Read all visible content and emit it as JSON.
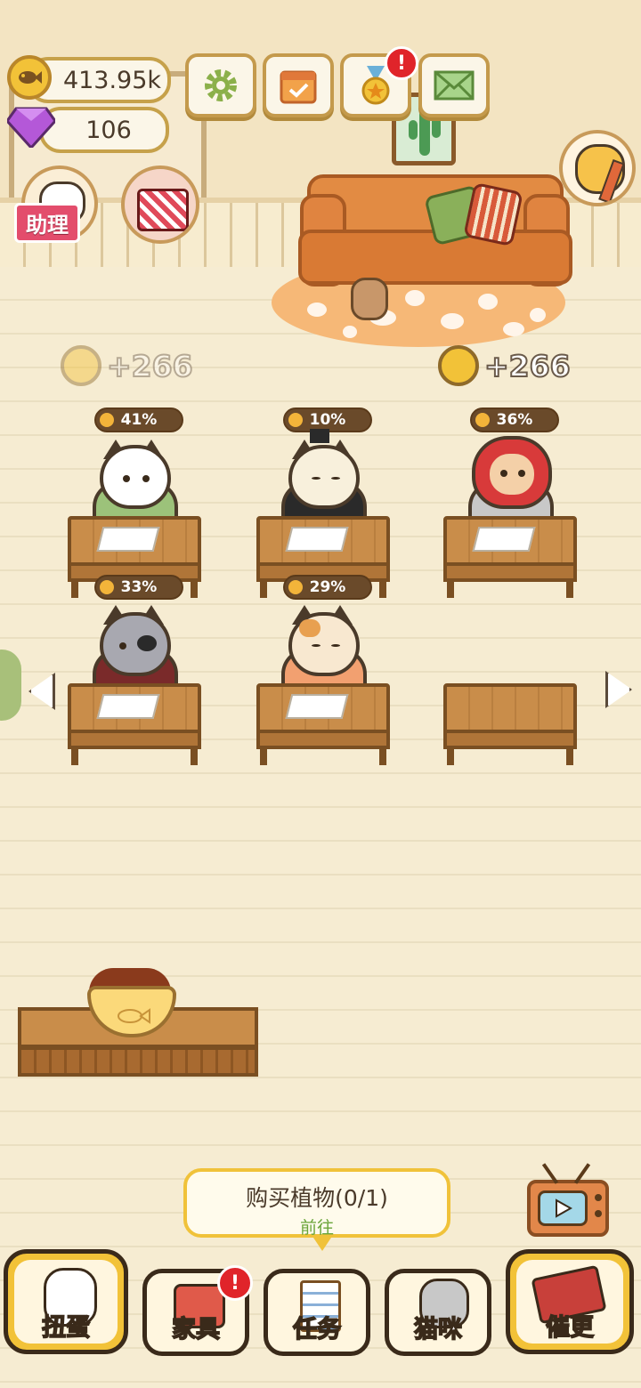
{
  "hud": {
    "coins": "413.95k",
    "gems": "106",
    "assistant_label": "助理",
    "mail_icon": "mail-icon",
    "settings_icon": "gear-icon",
    "calendar_icon": "calendar-icon",
    "medal_icon": "medal-icon",
    "alert": "!"
  },
  "earnings": {
    "left": "+266",
    "right": "+266"
  },
  "students": [
    {
      "progress": "41%"
    },
    {
      "progress": "10%"
    },
    {
      "progress": "36%"
    },
    {
      "progress": "33%"
    },
    {
      "progress": "29%"
    }
  ],
  "task": {
    "title": "购买植物(0/1)",
    "action": "前往"
  },
  "nav": {
    "gacha": "扭蛋",
    "furniture": "家具",
    "tasks": "任务",
    "cats": "猫咪",
    "urge": "催更",
    "alert": "!"
  },
  "colors": {
    "accent": "#f2c238",
    "alert": "#e0242a",
    "floor": "#f6ecd2",
    "wood": "#c98d4a"
  }
}
